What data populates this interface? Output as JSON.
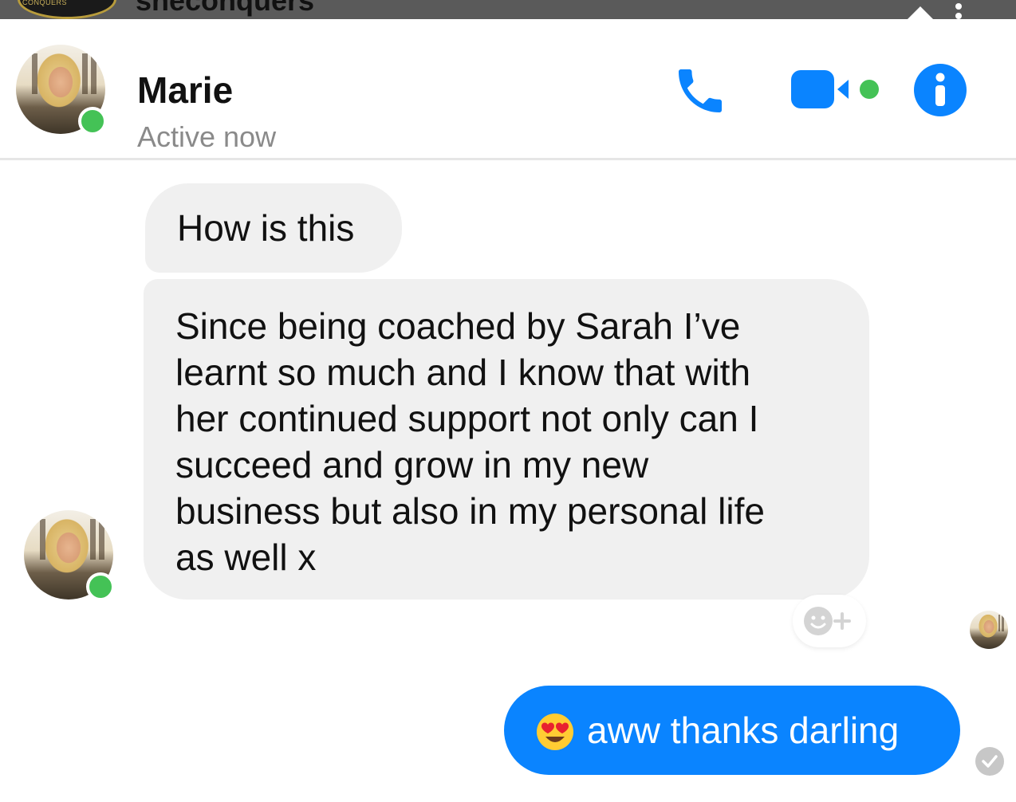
{
  "top_bar": {
    "handle_text": "sheconquers",
    "badge_text": "CONQUERS"
  },
  "header": {
    "contact_name": "Marie",
    "presence_status": "Active now",
    "icons": [
      "phone-icon",
      "video-camera-icon",
      "info-icon"
    ],
    "accent_color": "#0a84ff",
    "online_color": "#44c256"
  },
  "messages": [
    {
      "from": "contact",
      "text": "How is this"
    },
    {
      "from": "contact",
      "text": "Since being coached by Sarah I’ve\nlearnt so much and  I know that with\nher continued support not only can I\nsucceed and grow in my new\nbusiness but also in my personal life\nas well x"
    },
    {
      "from": "me",
      "emoji": "smiling-face-with-heart-eyes",
      "text": "aww thanks darling"
    }
  ],
  "reaction_button": {
    "icon": "add-reaction-icon"
  },
  "read_receipt": {
    "icon": "seen-avatar"
  },
  "delivered": {
    "icon": "check-circle-icon"
  }
}
